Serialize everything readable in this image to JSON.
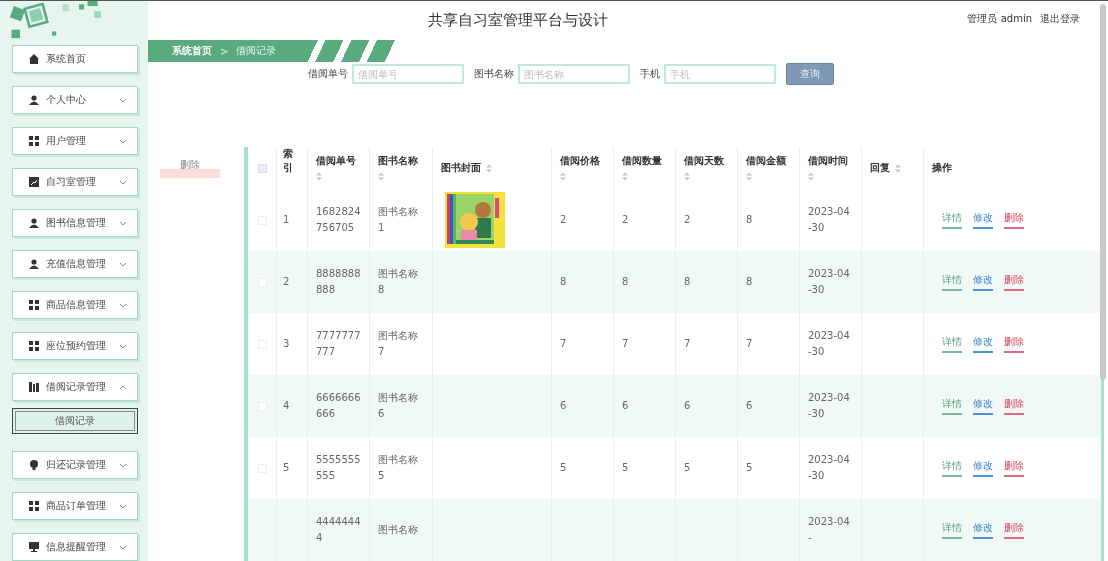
{
  "header": {
    "title": "共享自习室管理平台与设计",
    "user": "管理员 admin",
    "logout": "退出登录"
  },
  "sidebar": {
    "items": [
      {
        "label": "系统首页",
        "kind": "link"
      },
      {
        "label": "个人中心",
        "kind": "menu",
        "expanded": false
      },
      {
        "label": "用户管理",
        "kind": "menu",
        "expanded": false
      },
      {
        "label": "自习室管理",
        "kind": "menu",
        "expanded": false
      },
      {
        "label": "图书信息管理",
        "kind": "menu",
        "expanded": false
      },
      {
        "label": "充值信息管理",
        "kind": "menu",
        "expanded": false
      },
      {
        "label": "商品信息管理",
        "kind": "menu",
        "expanded": false
      },
      {
        "label": "座位预约管理",
        "kind": "menu",
        "expanded": false
      },
      {
        "label": "借阅记录管理",
        "kind": "menu",
        "expanded": true,
        "children": [
          {
            "label": "借阅记录",
            "selected": true
          }
        ]
      },
      {
        "label": "归还记录管理",
        "kind": "menu",
        "expanded": false
      },
      {
        "label": "商品订单管理",
        "kind": "menu",
        "expanded": false
      },
      {
        "label": "信息提醒管理",
        "kind": "menu",
        "expanded": false
      }
    ]
  },
  "breadcrumb": {
    "home": "系统首页",
    "separator": ">",
    "current": "借阅记录"
  },
  "search": {
    "fields": [
      {
        "label": "借阅单号",
        "placeholder": "借阅单号"
      },
      {
        "label": "图书名称",
        "placeholder": "图书名称"
      },
      {
        "label": "手机",
        "placeholder": "手机"
      }
    ],
    "button": "查询"
  },
  "delete_button": "删除",
  "table": {
    "select_all": {
      "checked": false
    },
    "columns": [
      {
        "label": "索引",
        "sortable": false
      },
      {
        "label": "借阅单号",
        "sortable": true
      },
      {
        "label": "图书名称",
        "sortable": true
      },
      {
        "label": "图书封面",
        "sortable": true
      },
      {
        "label": "借阅价格",
        "sortable": true
      },
      {
        "label": "借阅数量",
        "sortable": true
      },
      {
        "label": "借阅天数",
        "sortable": true
      },
      {
        "label": "借阅金额",
        "sortable": true
      },
      {
        "label": "借阅时间",
        "sortable": true
      },
      {
        "label": "回复",
        "sortable": true
      },
      {
        "label": "操作",
        "sortable": false
      }
    ],
    "rows": [
      {
        "checked": false,
        "index": "1",
        "order_no": "1682824756705",
        "book_name": "图书名称1",
        "price": "2",
        "quantity": "2",
        "days": "2",
        "amount": "8",
        "time": "2023-04-30",
        "actions": [
          "详情",
          "修改",
          "删除"
        ]
      },
      {
        "checked": false,
        "index": "2",
        "order_no": "8888888888",
        "book_name": "图书名称8",
        "price": "8",
        "quantity": "8",
        "days": "8",
        "amount": "8",
        "time": "2023-04-30",
        "actions": [
          "详情",
          "修改",
          "删除"
        ]
      },
      {
        "checked": false,
        "index": "3",
        "order_no": "7777777777",
        "book_name": "图书名称7",
        "price": "7",
        "quantity": "7",
        "days": "7",
        "amount": "7",
        "time": "2023-04-30",
        "actions": [
          "详情",
          "修改",
          "删除"
        ]
      },
      {
        "checked": false,
        "index": "4",
        "order_no": "6666666666",
        "book_name": "图书名称6",
        "price": "6",
        "quantity": "6",
        "days": "6",
        "amount": "6",
        "time": "2023-04-30",
        "actions": [
          "详情",
          "修改",
          "删除"
        ]
      },
      {
        "checked": false,
        "index": "5",
        "order_no": "5555555555",
        "book_name": "图书名称5",
        "price": "5",
        "quantity": "5",
        "days": "5",
        "amount": "5",
        "time": "2023-04-30",
        "actions": [
          "详情",
          "修改",
          "删除"
        ]
      },
      {
        "order_no": "44444444",
        "book_name": "图书名称",
        "time": "2023-04-",
        "actions": [
          "详情",
          "修改",
          "删除"
        ]
      }
    ]
  }
}
